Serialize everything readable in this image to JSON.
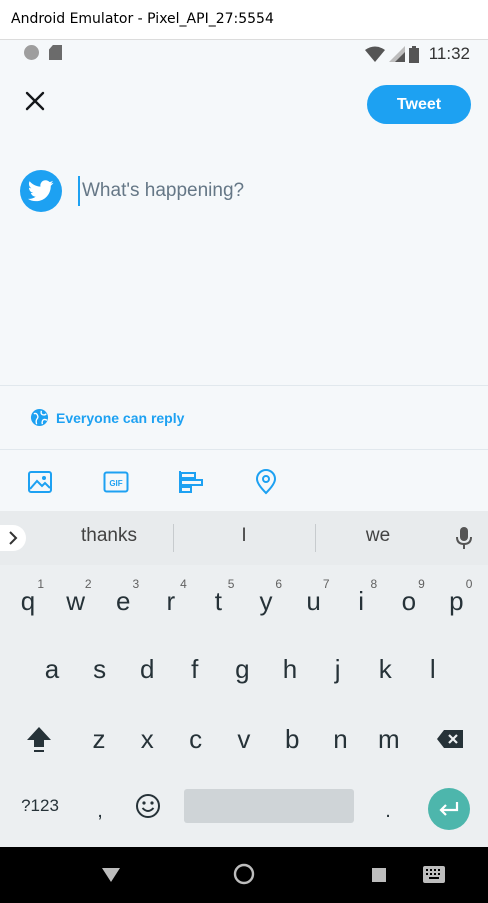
{
  "window": {
    "title": "Android Emulator - Pixel_API_27:5554"
  },
  "status_bar": {
    "time": "11:32"
  },
  "compose": {
    "tweet_label": "Tweet",
    "placeholder": "What's happening?",
    "value": "",
    "reply_setting": "Everyone can reply"
  },
  "toolbar": {
    "icons": [
      "image-icon",
      "gif-icon",
      "poll-icon",
      "location-icon"
    ],
    "gif_label": "GIF"
  },
  "keyboard": {
    "suggestions": [
      "thanks",
      "I",
      "we"
    ],
    "row1": [
      {
        "k": "q",
        "h": "1"
      },
      {
        "k": "w",
        "h": "2"
      },
      {
        "k": "e",
        "h": "3"
      },
      {
        "k": "r",
        "h": "4"
      },
      {
        "k": "t",
        "h": "5"
      },
      {
        "k": "y",
        "h": "6"
      },
      {
        "k": "u",
        "h": "7"
      },
      {
        "k": "i",
        "h": "8"
      },
      {
        "k": "o",
        "h": "9"
      },
      {
        "k": "p",
        "h": "0"
      }
    ],
    "row2": [
      "a",
      "s",
      "d",
      "f",
      "g",
      "h",
      "j",
      "k",
      "l"
    ],
    "row3": [
      "z",
      "x",
      "c",
      "v",
      "b",
      "n",
      "m"
    ],
    "symbols_label": "?123",
    "comma_label": ",",
    "period_label": "."
  },
  "colors": {
    "accent": "#1da1f2",
    "enter": "#4db6ac",
    "background": "#f5f8fa"
  }
}
